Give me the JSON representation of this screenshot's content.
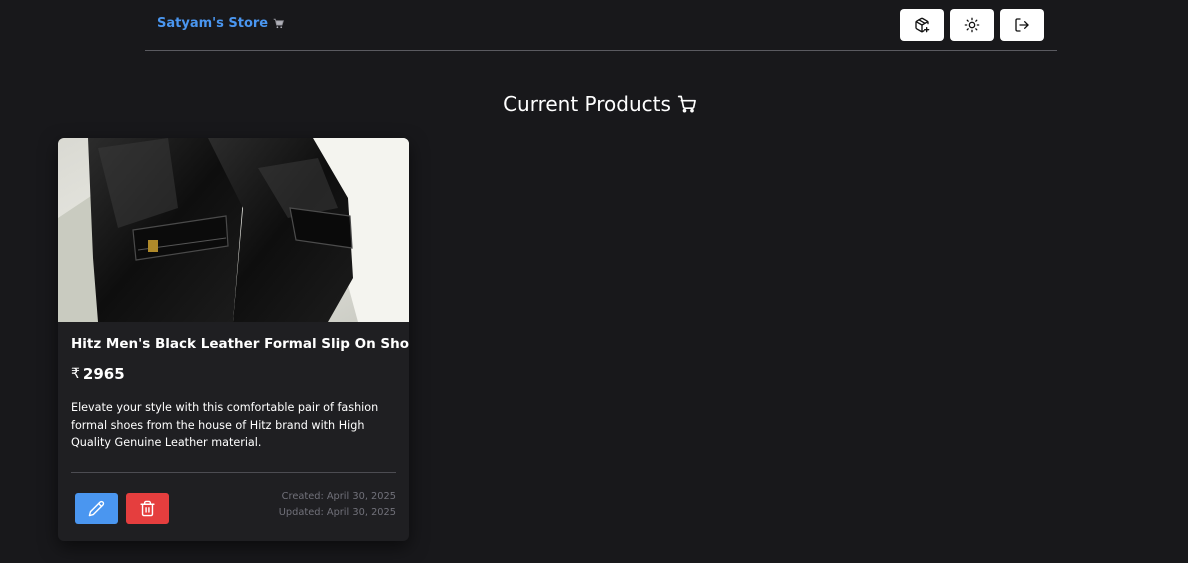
{
  "header": {
    "brand": "Satyam's Store",
    "icons": [
      "shopping-cart-icon",
      "package-plus-icon",
      "sun-icon",
      "logout-icon"
    ]
  },
  "main": {
    "title": "Current Products"
  },
  "products": [
    {
      "name": "Hitz Men's Black Leather Formal Slip On Shoes",
      "currency": "₹",
      "price": "2965",
      "description": "Elevate your style with this comfortable pair of fashion formal shoes from the house of Hitz brand with High Quality Genuine Leather material.",
      "created": "Created: April 30, 2025",
      "updated": "Updated: April 30, 2025",
      "image": "black-leather-slip-on-shoes"
    }
  ],
  "colors": {
    "background": "#18181b",
    "card": "#1f1f22",
    "accent": "#4a96f0",
    "danger": "#e53e3e"
  }
}
